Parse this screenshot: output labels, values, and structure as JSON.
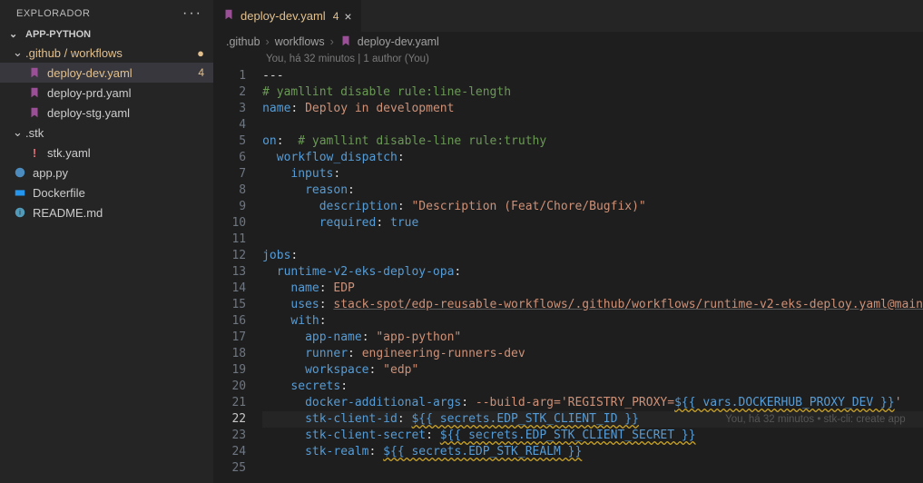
{
  "sidebar": {
    "title": "EXPLORADOR",
    "project": "APP-PYTHON",
    "items": [
      {
        "name": ".github / workflows",
        "kind": "folder",
        "open": true,
        "indent": 0,
        "dirty": true,
        "dot": "●"
      },
      {
        "name": "deploy-dev.yaml",
        "kind": "file",
        "indent": 1,
        "icon": "yaml",
        "selected": true,
        "badge": "4"
      },
      {
        "name": "deploy-prd.yaml",
        "kind": "file",
        "indent": 1,
        "icon": "yaml"
      },
      {
        "name": "deploy-stg.yaml",
        "kind": "file",
        "indent": 1,
        "icon": "yaml"
      },
      {
        "name": ".stk",
        "kind": "folder",
        "open": true,
        "indent": 0
      },
      {
        "name": "stk.yaml",
        "kind": "file",
        "indent": 1,
        "icon": "bang"
      },
      {
        "name": "app.py",
        "kind": "file",
        "indent": 0,
        "icon": "py"
      },
      {
        "name": "Dockerfile",
        "kind": "file",
        "indent": 0,
        "icon": "docker"
      },
      {
        "name": "README.md",
        "kind": "file",
        "indent": 0,
        "icon": "info"
      }
    ]
  },
  "tab": {
    "icon": "yaml",
    "label": "deploy-dev.yaml",
    "badge": "4"
  },
  "breadcrumb": [
    ".github",
    "workflows",
    "deploy-dev.yaml"
  ],
  "blame_header": "You, há 32 minutos | 1 author (You)",
  "inline_blame": "You, há 32 minutos • stk-cli: create app",
  "code": {
    "lines": [
      {
        "n": 1,
        "segs": [
          {
            "t": "---",
            "c": "tok-punc"
          }
        ]
      },
      {
        "n": 2,
        "segs": [
          {
            "t": "# yamllint disable rule:line-length",
            "c": "tok-comment"
          }
        ]
      },
      {
        "n": 3,
        "segs": [
          {
            "t": "name",
            "c": "tok-key"
          },
          {
            "t": ": ",
            "c": "tok-punc"
          },
          {
            "t": "Deploy in development",
            "c": "tok-str"
          }
        ]
      },
      {
        "n": 4,
        "segs": []
      },
      {
        "n": 5,
        "segs": [
          {
            "t": "on",
            "c": "tok-key"
          },
          {
            "t": ":  ",
            "c": "tok-punc"
          },
          {
            "t": "# yamllint disable-line rule:truthy",
            "c": "tok-comment"
          }
        ]
      },
      {
        "n": 6,
        "segs": [
          {
            "t": "  ",
            "c": ""
          },
          {
            "t": "workflow_dispatch",
            "c": "tok-key"
          },
          {
            "t": ":",
            "c": "tok-punc"
          }
        ]
      },
      {
        "n": 7,
        "segs": [
          {
            "t": "    ",
            "c": ""
          },
          {
            "t": "inputs",
            "c": "tok-key"
          },
          {
            "t": ":",
            "c": "tok-punc"
          }
        ]
      },
      {
        "n": 8,
        "segs": [
          {
            "t": "      ",
            "c": ""
          },
          {
            "t": "reason",
            "c": "tok-key"
          },
          {
            "t": ":",
            "c": "tok-punc"
          }
        ]
      },
      {
        "n": 9,
        "segs": [
          {
            "t": "        ",
            "c": ""
          },
          {
            "t": "description",
            "c": "tok-key"
          },
          {
            "t": ": ",
            "c": "tok-punc"
          },
          {
            "t": "\"Description (Feat/Chore/Bugfix)\"",
            "c": "tok-str"
          }
        ]
      },
      {
        "n": 10,
        "segs": [
          {
            "t": "        ",
            "c": ""
          },
          {
            "t": "required",
            "c": "tok-key"
          },
          {
            "t": ": ",
            "c": "tok-punc"
          },
          {
            "t": "true",
            "c": "tok-bool"
          }
        ]
      },
      {
        "n": 11,
        "segs": []
      },
      {
        "n": 12,
        "segs": [
          {
            "t": "jobs",
            "c": "tok-key"
          },
          {
            "t": ":",
            "c": "tok-punc"
          }
        ]
      },
      {
        "n": 13,
        "segs": [
          {
            "t": "  ",
            "c": ""
          },
          {
            "t": "runtime-v2-eks-deploy-opa",
            "c": "tok-key"
          },
          {
            "t": ":",
            "c": "tok-punc"
          }
        ]
      },
      {
        "n": 14,
        "segs": [
          {
            "t": "    ",
            "c": ""
          },
          {
            "t": "name",
            "c": "tok-key"
          },
          {
            "t": ": ",
            "c": "tok-punc"
          },
          {
            "t": "EDP",
            "c": "tok-str"
          }
        ]
      },
      {
        "n": 15,
        "segs": [
          {
            "t": "    ",
            "c": ""
          },
          {
            "t": "uses",
            "c": "tok-key"
          },
          {
            "t": ": ",
            "c": "tok-punc"
          },
          {
            "t": "stack-spot/edp-reusable-workflows/.github/workflows/runtime-v2-eks-deploy.yaml@main",
            "c": "tok-link"
          }
        ]
      },
      {
        "n": 16,
        "segs": [
          {
            "t": "    ",
            "c": ""
          },
          {
            "t": "with",
            "c": "tok-key"
          },
          {
            "t": ":",
            "c": "tok-punc"
          }
        ]
      },
      {
        "n": 17,
        "segs": [
          {
            "t": "      ",
            "c": ""
          },
          {
            "t": "app-name",
            "c": "tok-key"
          },
          {
            "t": ": ",
            "c": "tok-punc"
          },
          {
            "t": "\"app-python\"",
            "c": "tok-str"
          }
        ]
      },
      {
        "n": 18,
        "segs": [
          {
            "t": "      ",
            "c": ""
          },
          {
            "t": "runner",
            "c": "tok-key"
          },
          {
            "t": ": ",
            "c": "tok-punc"
          },
          {
            "t": "engineering-runners-dev",
            "c": "tok-str"
          }
        ]
      },
      {
        "n": 19,
        "segs": [
          {
            "t": "      ",
            "c": ""
          },
          {
            "t": "workspace",
            "c": "tok-key"
          },
          {
            "t": ": ",
            "c": "tok-punc"
          },
          {
            "t": "\"edp\"",
            "c": "tok-str"
          }
        ]
      },
      {
        "n": 20,
        "segs": [
          {
            "t": "    ",
            "c": ""
          },
          {
            "t": "secrets",
            "c": "tok-key"
          },
          {
            "t": ":",
            "c": "tok-punc"
          }
        ]
      },
      {
        "n": 21,
        "segs": [
          {
            "t": "      ",
            "c": ""
          },
          {
            "t": "docker-additional-args",
            "c": "tok-key"
          },
          {
            "t": ": ",
            "c": "tok-punc"
          },
          {
            "t": "--build-arg='REGISTRY_PROXY=",
            "c": "tok-str"
          },
          {
            "t": "${{ vars.DOCKERHUB_PROXY_DEV }}",
            "c": "tok-var"
          },
          {
            "t": "'",
            "c": "tok-str"
          }
        ]
      },
      {
        "n": 22,
        "active": true,
        "segs": [
          {
            "t": "      ",
            "c": ""
          },
          {
            "t": "stk-client-id",
            "c": "tok-key"
          },
          {
            "t": ": ",
            "c": "tok-punc"
          },
          {
            "t": "${{ secrets.EDP_STK_CLIENT_ID }}",
            "c": "tok-var"
          }
        ],
        "blame": true
      },
      {
        "n": 23,
        "segs": [
          {
            "t": "      ",
            "c": ""
          },
          {
            "t": "stk-client-secret",
            "c": "tok-key"
          },
          {
            "t": ": ",
            "c": "tok-punc"
          },
          {
            "t": "${{ secrets.EDP_STK_CLIENT_SECRET }}",
            "c": "tok-var"
          }
        ]
      },
      {
        "n": 24,
        "segs": [
          {
            "t": "      ",
            "c": ""
          },
          {
            "t": "stk-realm",
            "c": "tok-key"
          },
          {
            "t": ": ",
            "c": "tok-punc"
          },
          {
            "t": "${{ secrets.EDP_STK_REALM }}",
            "c": "tok-var"
          }
        ]
      },
      {
        "n": 25,
        "segs": []
      }
    ]
  }
}
